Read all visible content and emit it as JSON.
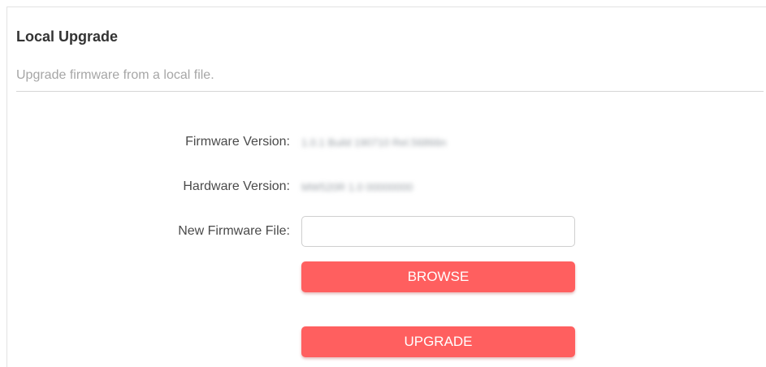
{
  "section": {
    "title": "Local Upgrade",
    "description": "Upgrade firmware from a local file."
  },
  "form": {
    "firmware_version": {
      "label": "Firmware Version:",
      "value": "1.0.1 Build 190710 Rel.56866n"
    },
    "hardware_version": {
      "label": "Hardware Version:",
      "value": "MW520R 1.0 00000000"
    },
    "new_firmware_file": {
      "label": "New Firmware File:",
      "value": ""
    }
  },
  "buttons": {
    "browse_label": "BROWSE",
    "upgrade_label": "UPGRADE"
  },
  "colors": {
    "accent": "#ff5f5f",
    "title_text": "#333333",
    "description_text": "#a6a6a6"
  }
}
